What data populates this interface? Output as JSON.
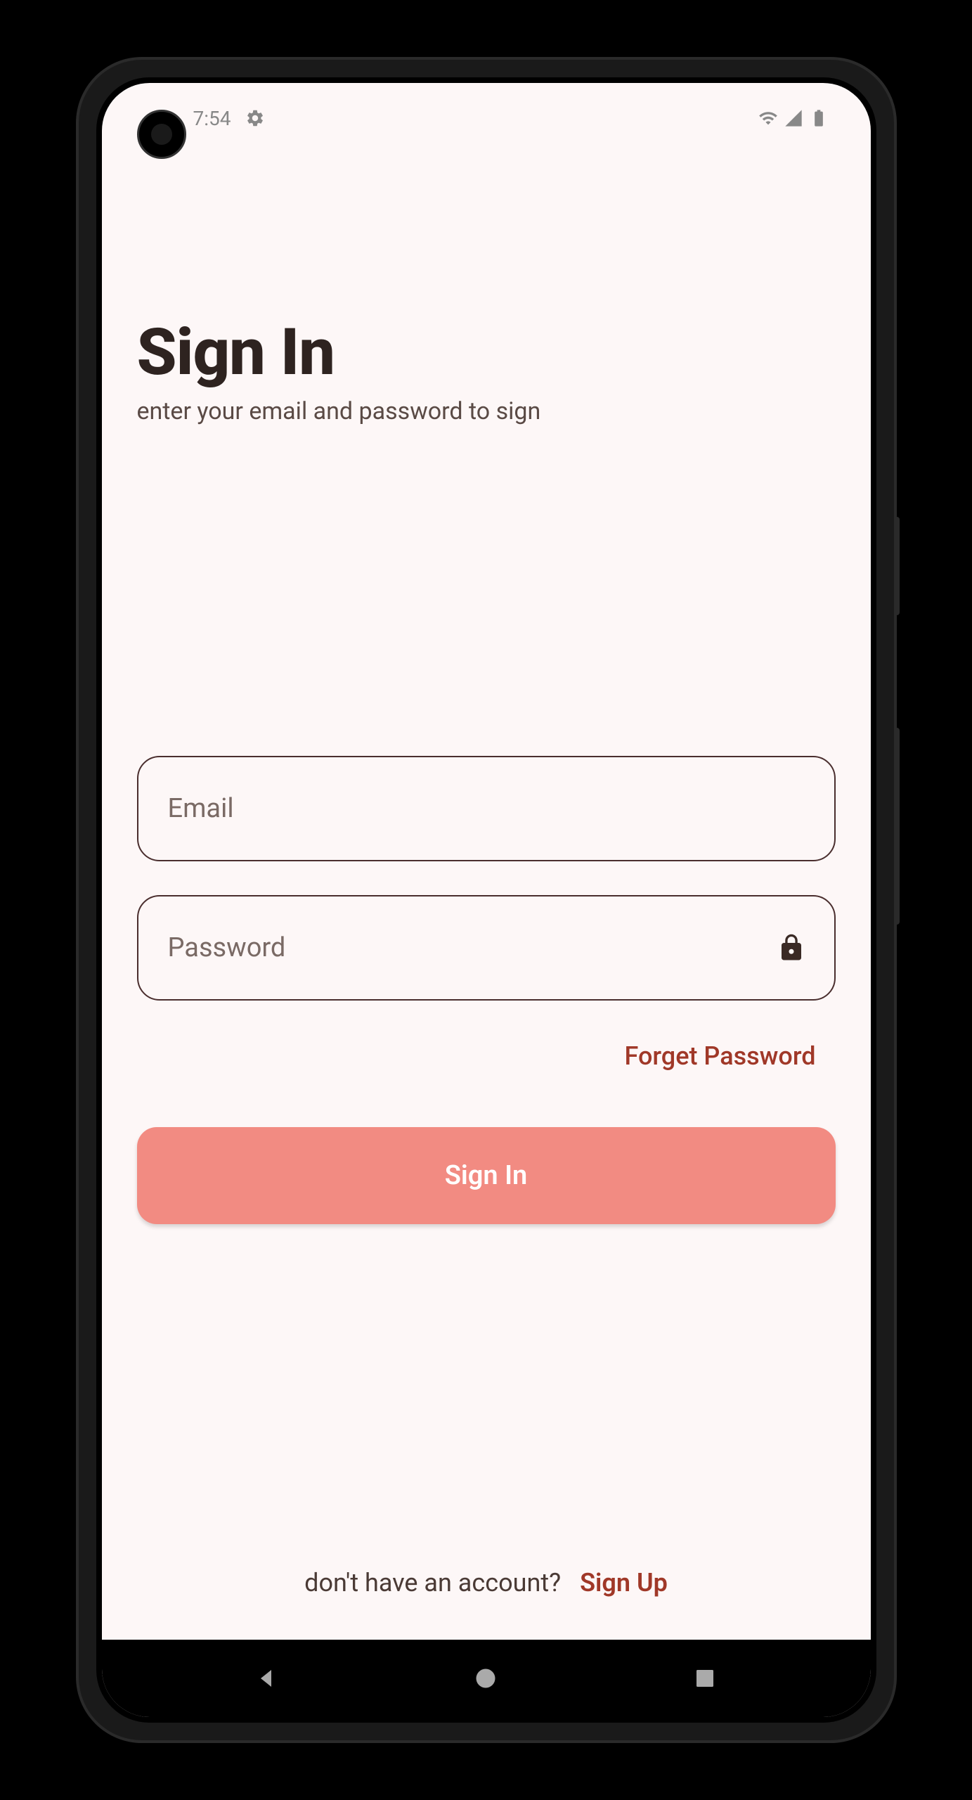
{
  "status": {
    "time": "7:54",
    "gear_icon": "gear"
  },
  "header": {
    "title": "Sign In",
    "subtitle": "enter your email and password to sign"
  },
  "form": {
    "email_placeholder": "Email",
    "email_value": "",
    "password_placeholder": "Password",
    "password_value": "",
    "forgot_label": "Forget Password",
    "signin_label": "Sign In"
  },
  "footer": {
    "prompt": "don't have an account?",
    "signup_label": "Sign Up"
  }
}
